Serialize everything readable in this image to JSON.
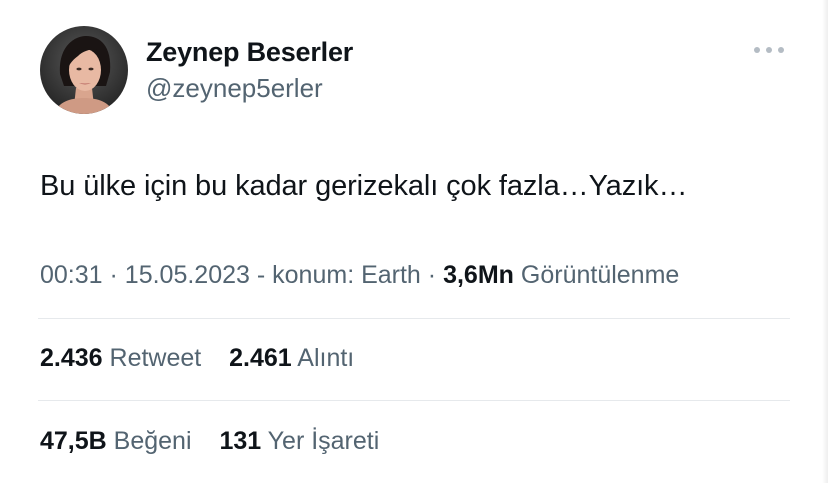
{
  "user": {
    "display_name": "Zeynep Beserler",
    "handle": "@zeynep5erler"
  },
  "tweet": {
    "text": "Bu ülke için bu kadar gerizekalı çok fazla…Yazık…"
  },
  "meta": {
    "time": "00:31",
    "sep1": "·",
    "date": "15.05.2023",
    "sep2": "-",
    "location": "konum: Earth",
    "sep3": "·",
    "views_count": "3,6Mn",
    "views_label": "Görüntülenme"
  },
  "stats": {
    "retweets_count": "2.436",
    "retweets_label": "Retweet",
    "quotes_count": "2.461",
    "quotes_label": "Alıntı",
    "likes_count": "47,5B",
    "likes_label": "Beğeni",
    "bookmarks_count": "131",
    "bookmarks_label": "Yer İşareti"
  },
  "icons": {
    "more": "more-horizontal-icon"
  },
  "colors": {
    "text_primary": "#0f1419",
    "text_secondary": "#536471",
    "divider": "#e6e9ec"
  }
}
